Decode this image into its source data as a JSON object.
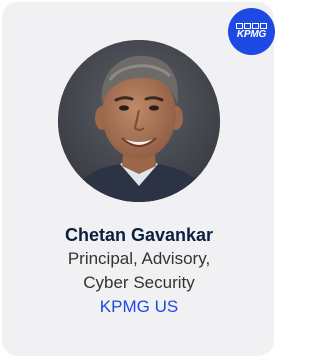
{
  "logo": {
    "text": "KPMG"
  },
  "person": {
    "name": "Chetan Gavankar",
    "title_line1": "Principal, Advisory,",
    "title_line2": "Cyber Security",
    "company": "KPMG US"
  },
  "colors": {
    "brand": "#1e49e2",
    "name": "#0b1f3f",
    "text": "#333333",
    "card_bg": "#f1f1f3"
  }
}
